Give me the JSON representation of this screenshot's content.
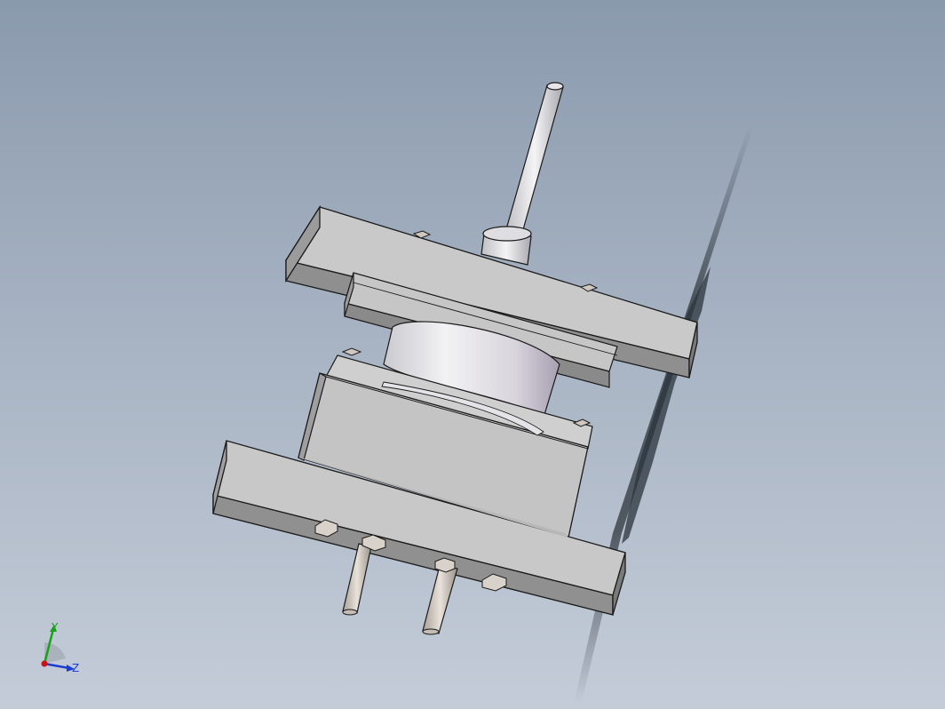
{
  "triad": {
    "y_label": "Y",
    "z_label": "Z",
    "colors": {
      "x_axis": "#d01010",
      "y_axis": "#18a018",
      "z_axis": "#1a3fd0"
    }
  },
  "scene": {
    "background_top": "#8a9aad",
    "background_bottom": "#c4ccd8",
    "part_face_color": "#c8c8c8",
    "part_edge_color": "#1a1a1a"
  }
}
